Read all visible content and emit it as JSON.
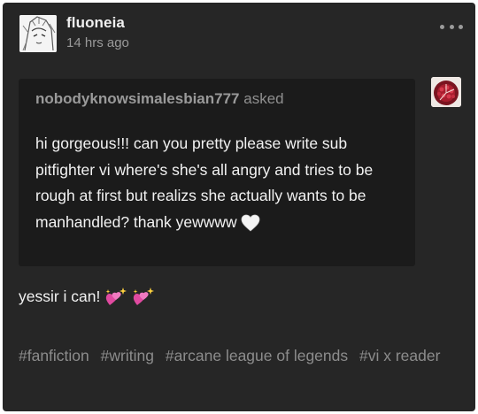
{
  "post": {
    "blog_name": "fluoneia",
    "timestamp": "14 hrs ago",
    "more_icon": "ellipsis-icon"
  },
  "ask": {
    "asker": "nobodyknowsimalesbian777",
    "asked_label": "asked",
    "question": "hi gorgeous!!! can you pretty please write sub pitfighter vi where's she's all angry and tries to be rough at first but realizs she actually wants to be manhandled? thank yewwww",
    "emoji": "white-heart"
  },
  "answer": {
    "text": "yessir i can!",
    "emoji": [
      "sparkling-heart",
      "sparkling-heart"
    ]
  },
  "tags": [
    "#fanfiction",
    "#writing",
    "#arcane league of legends",
    "#vi x reader"
  ],
  "colors": {
    "post_bg": "#262626",
    "ask_bg": "#1b1b1b",
    "text": "#f2f2f2",
    "muted": "#8c8c8c",
    "heart_pink": "#e04aa0"
  }
}
